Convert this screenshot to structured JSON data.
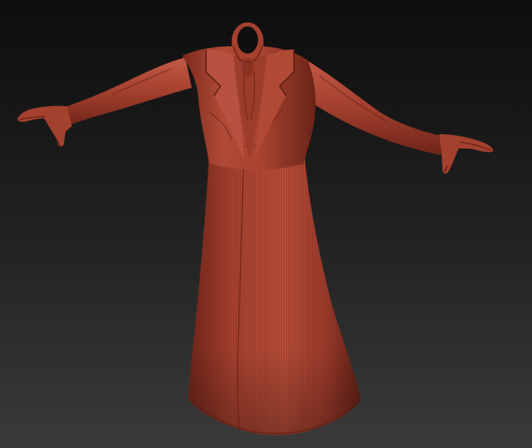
{
  "scene": {
    "subject": "headless-long-coat-sculpt",
    "icon": "sculpt-model-icon",
    "colors": {
      "background_top": "#0e0e0e",
      "background_bottom": "#3a3a3a",
      "clay_base": "#a4402e",
      "clay_light": "#c25a46",
      "clay_shadow": "#6e2519",
      "clay_deep": "#4a160e"
    }
  }
}
